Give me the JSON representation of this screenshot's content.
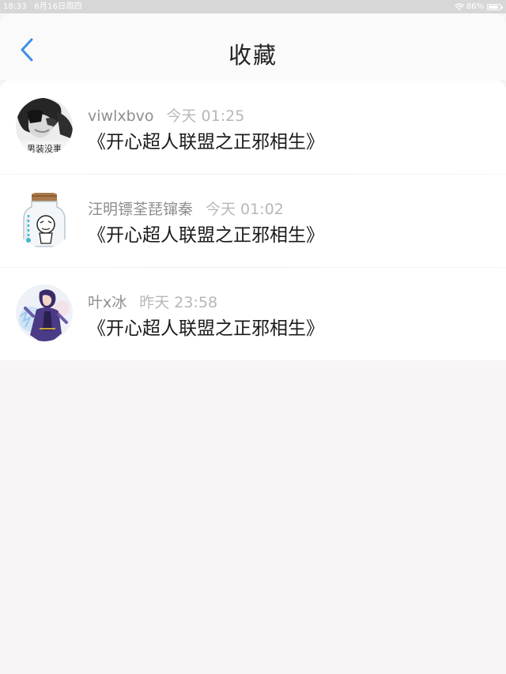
{
  "status_bar": {
    "time": "18:33",
    "date": "6月16日周四",
    "battery_percent": "86%",
    "battery_level": 0.86
  },
  "nav": {
    "title": "收藏"
  },
  "favorites": [
    {
      "username": "viwlxbvo",
      "time": "今天 01:25",
      "title": "《开心超人联盟之正邪相生》",
      "avatar_text": "男装没事"
    },
    {
      "username": "汪明镖荃琵镩秦",
      "time": "今天 01:02",
      "title": "《开心超人联盟之正邪相生》"
    },
    {
      "username": "叶x冰",
      "time": "昨天 23:58",
      "title": "《开心超人联盟之正邪相生》"
    }
  ],
  "colors": {
    "accent": "#3b8fe6",
    "background": "#f7f5f6",
    "status_bar": "#d7d7d7"
  }
}
